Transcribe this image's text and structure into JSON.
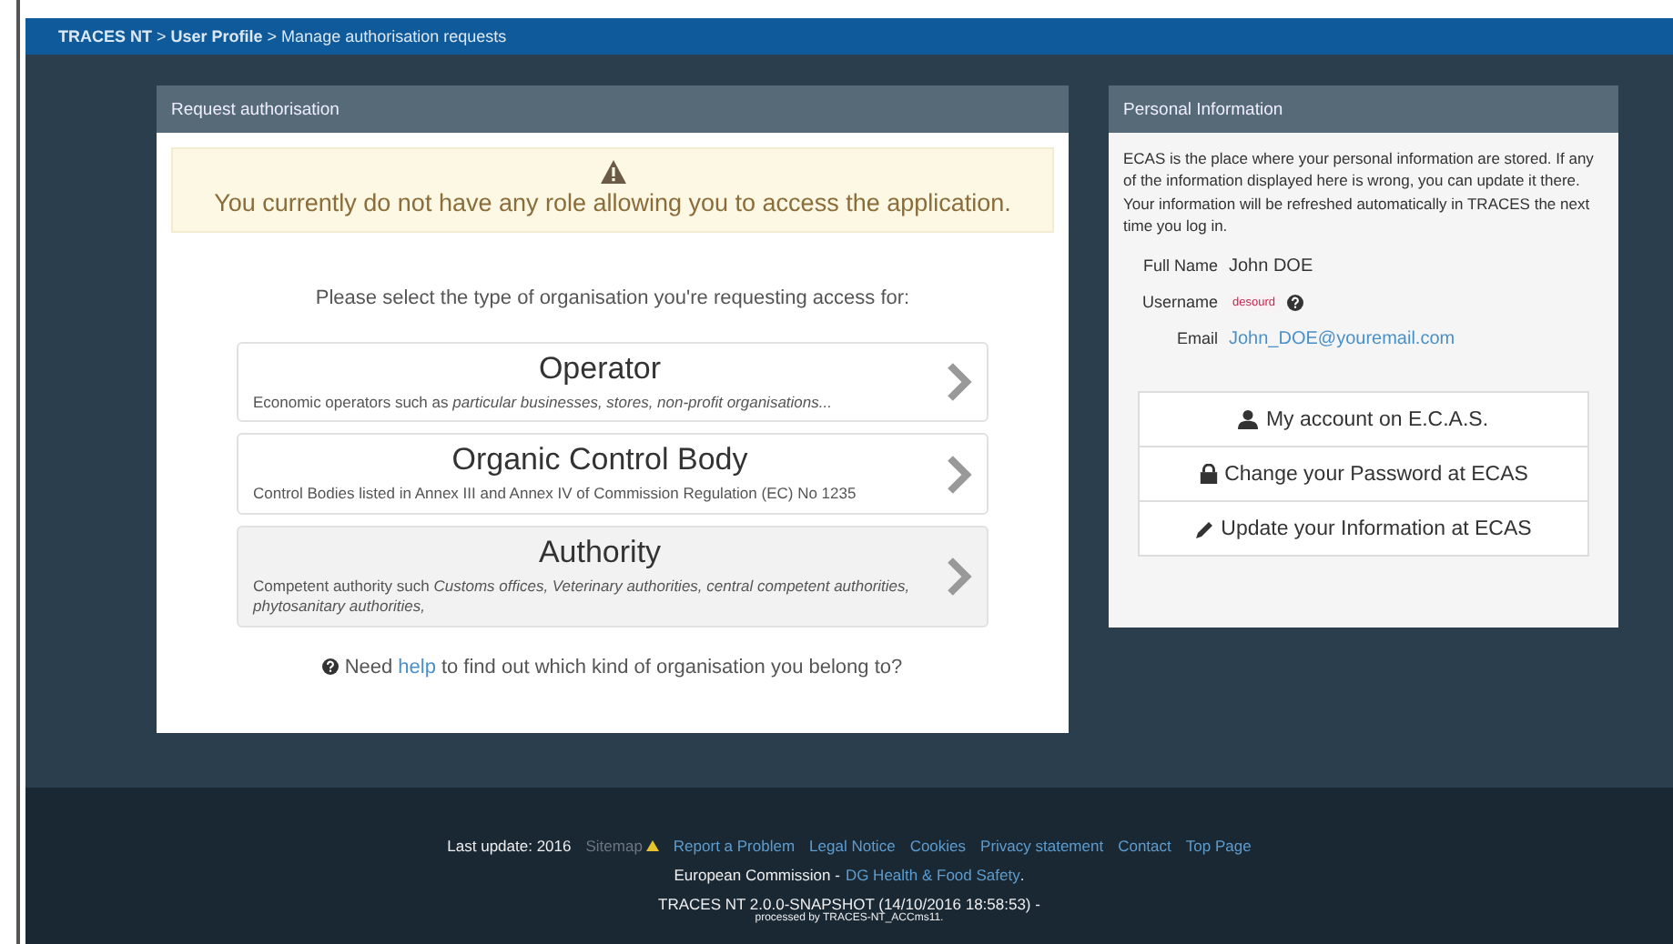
{
  "breadcrumb": "**TRACES NT** > **User Profile** > Manage authorisation requests",
  "request_panel": {
    "title": "Request authorisation",
    "warning": "You currently do not have any role allowing you to access the application.",
    "prompt": "Please select the type of organisation you're requesting access for:",
    "options": [
      {
        "title": "Operator",
        "description": "Economic operators such as *particular businesses, stores, non-profit organisations...*",
        "selected": false
      },
      {
        "title": "Organic Control Body",
        "description": "Control Bodies listed in Annex III and Annex IV of Commission Regulation (EC) No 1235",
        "selected": false
      },
      {
        "title": "Authority",
        "description": "Competent authority such *Customs offices, Veterinary authorities, central competent authorities, phytosanitary authorities,*",
        "selected": true
      }
    ],
    "help": {
      "before": "Need",
      "link": "help",
      "after": "to find out which kind of organisation you belong to?"
    }
  },
  "personal_panel": {
    "title": "Personal Information",
    "intro": "ECAS is the place where your personal information are stored. If any of the information displayed here is wrong, you can update it there. Your information will be refreshed automatically in TRACES the next time you log in.",
    "fields": [
      {
        "label": "Full Name",
        "value": "John DOE",
        "kind": "text"
      },
      {
        "label": "Username",
        "value": "desourd",
        "kind": "code"
      },
      {
        "label": "Email",
        "value": "John_DOE@youremail.com",
        "kind": "link"
      }
    ],
    "buttons": [
      {
        "label": "My account on E.C.A.S.",
        "kind": "user"
      },
      {
        "label": "Change your Password at ECAS",
        "kind": "lock"
      },
      {
        "label": "Update your Information at ECAS",
        "kind": "pencil"
      }
    ]
  },
  "footer": {
    "last_update": "Last update: 2016",
    "links": [
      {
        "label": "Sitemap",
        "disabled": true
      },
      {
        "label": "Report a Problem",
        "disabled": false
      },
      {
        "label": "Legal Notice",
        "disabled": false
      },
      {
        "label": "Cookies",
        "disabled": false
      },
      {
        "label": "Privacy statement",
        "disabled": false
      },
      {
        "label": "Contact",
        "disabled": false
      },
      {
        "label": "Top Page",
        "disabled": false
      }
    ],
    "commission": "European Commission -",
    "commission_link": "DG Health & Food Safety",
    "commission_end": ".",
    "version": "TRACES NT 2.0.0-SNAPSHOT (14/10/2016 18:58:53) -",
    "processed": "processed by TRACES-NT_ACCms11."
  }
}
